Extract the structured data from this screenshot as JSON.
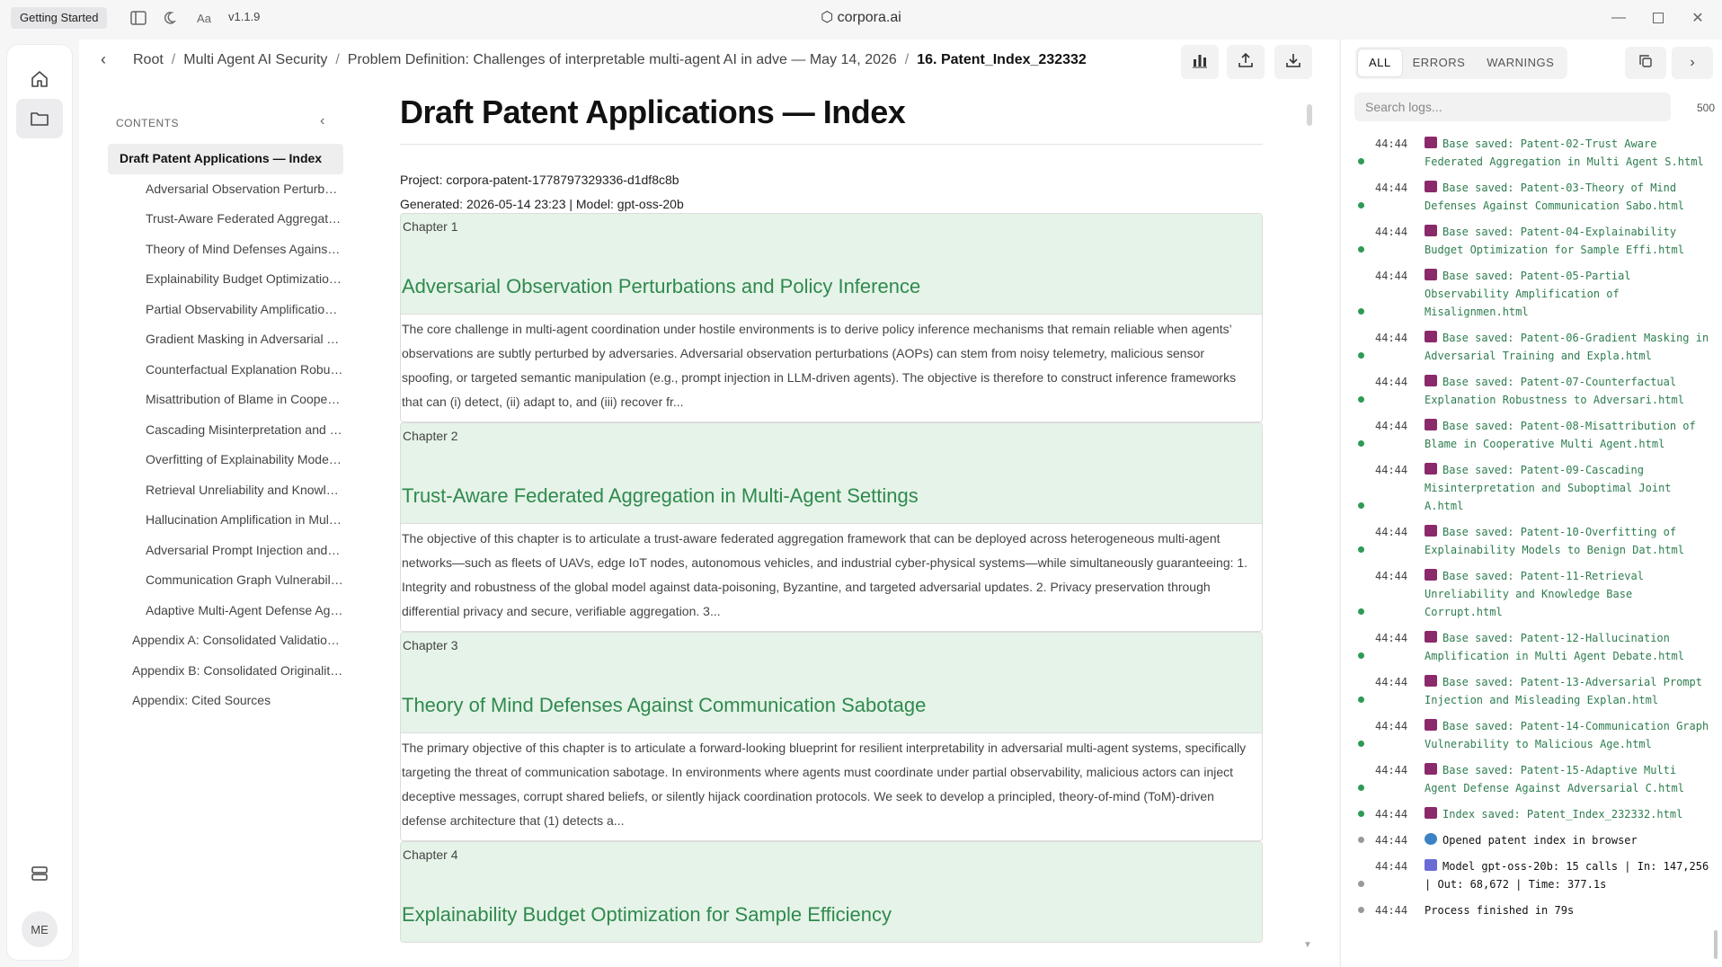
{
  "titlebar": {
    "getting_started": "Getting Started",
    "version": "v1.1.9",
    "app_title": "corpora.ai",
    "icons": [
      "sidebar-toggle-icon",
      "moon-icon",
      "font-size-icon",
      "logo-icon",
      "minimize-icon",
      "maximize-icon",
      "close-icon"
    ]
  },
  "rail": {
    "avatar": "ME",
    "icons": [
      "home-icon",
      "folder-icon",
      "database-icon"
    ]
  },
  "breadcrumb": {
    "items": [
      "Root",
      "Multi Agent AI Security",
      "Problem Definition: Challenges of interpretable multi-agent AI in adve — May 14, 2026"
    ],
    "current": "16. Patent_Index_232332"
  },
  "toc": {
    "heading": "CONTENTS",
    "items": [
      {
        "label": "Draft Patent Applications — Index",
        "level": 0
      },
      {
        "label": "Adversarial Observation Perturbations and Policy Inference",
        "level": 2
      },
      {
        "label": "Trust-Aware Federated Aggregation in Multi-Agent Settings",
        "level": 2
      },
      {
        "label": "Theory of Mind Defenses Against Communication Sabotage",
        "level": 2
      },
      {
        "label": "Explainability Budget Optimization for Sample Efficiency",
        "level": 2
      },
      {
        "label": "Partial Observability Amplification of Misalignment",
        "level": 2
      },
      {
        "label": "Gradient Masking in Adversarial Training and Explanations",
        "level": 2
      },
      {
        "label": "Counterfactual Explanation Robustness to Adversaries",
        "level": 2
      },
      {
        "label": "Misattribution of Blame in Cooperative Multi Agent",
        "level": 2
      },
      {
        "label": "Cascading Misinterpretation and Suboptimal Joint Action",
        "level": 2
      },
      {
        "label": "Overfitting of Explainability Models to Benign Data",
        "level": 2
      },
      {
        "label": "Retrieval Unreliability and Knowledge Base Corruption",
        "level": 2
      },
      {
        "label": "Hallucination Amplification in Multi Agent Debate",
        "level": 2
      },
      {
        "label": "Adversarial Prompt Injection and Misleading Explanations",
        "level": 2
      },
      {
        "label": "Communication Graph Vulnerability to Malicious Agents",
        "level": 2
      },
      {
        "label": "Adaptive Multi-Agent Defense Against Adversarial Collusion",
        "level": 2
      },
      {
        "label": "Appendix A: Consolidated Validation Plan",
        "level": 1
      },
      {
        "label": "Appendix B: Consolidated Originality Review",
        "level": 1
      },
      {
        "label": "Appendix: Cited Sources",
        "level": 1
      }
    ]
  },
  "doc": {
    "title": "Draft Patent Applications — Index",
    "project": "Project: corpora-patent-1778797329336-d1df8c8b",
    "generated": "Generated: 2026-05-14 23:23 | Model: gpt-oss-20b",
    "chapters": [
      {
        "num": "Chapter 1",
        "title": "Adversarial Observation Perturbations and Policy Inference",
        "body": "The core challenge in multi-agent coordination under hostile environments is to derive policy inference mechanisms that remain reliable when agents’ observations are subtly perturbed by adversaries. Adversarial observation perturbations (AOPs) can stem from noisy telemetry, malicious sensor spoofing, or targeted semantic manipulation (e.g., prompt injection in LLM-driven agents). The objective is therefore to construct inference frameworks that can (i) detect, (ii) adapt to, and (iii) recover fr..."
      },
      {
        "num": "Chapter 2",
        "title": "Trust-Aware Federated Aggregation in Multi-Agent Settings",
        "body": "The objective of this chapter is to articulate a trust-aware federated aggregation framework that can be deployed across heterogeneous multi-agent networks—such as fleets of UAVs, edge IoT nodes, autonomous vehicles, and industrial cyber-physical systems—while simultaneously guaranteeing: 1. Integrity and robustness of the global model against data-poisoning, Byzantine, and targeted adversarial updates. 2. Privacy preservation through differential privacy and secure, verifiable aggregation. 3..."
      },
      {
        "num": "Chapter 3",
        "title": "Theory of Mind Defenses Against Communication Sabotage",
        "body": "The primary objective of this chapter is to articulate a forward-looking blueprint for resilient interpretability in adversarial multi-agent systems, specifically targeting the threat of communication sabotage. In environments where agents must coordinate under partial observability, malicious actors can inject deceptive messages, corrupt shared beliefs, or silently hijack coordination protocols. We seek to develop a principled, theory-of-mind (ToM)-driven defense architecture that (1) detects a..."
      },
      {
        "num": "Chapter 4",
        "title": "Explainability Budget Optimization for Sample Efficiency",
        "body": ""
      }
    ]
  },
  "logs_panel": {
    "tabs": [
      "ALL",
      "ERRORS",
      "WARNINGS"
    ],
    "search_placeholder": "Search logs...",
    "count": "500",
    "entries": [
      {
        "time": "44:44",
        "icon": "save",
        "text": "Base saved: Patent-02-Trust Aware Federated Aggregation in Multi Agent S.html",
        "kind": "ok"
      },
      {
        "time": "44:44",
        "icon": "save",
        "text": "Base saved: Patent-03-Theory of Mind Defenses Against Communication Sabo.html",
        "kind": "ok"
      },
      {
        "time": "44:44",
        "icon": "save",
        "text": "Base saved: Patent-04-Explainability Budget Optimization for Sample Effi.html",
        "kind": "ok"
      },
      {
        "time": "44:44",
        "icon": "save",
        "text": "Base saved: Patent-05-Partial Observability Amplification of Misalignmen.html",
        "kind": "ok"
      },
      {
        "time": "44:44",
        "icon": "save",
        "text": "Base saved: Patent-06-Gradient Masking in Adversarial Training and Expla.html",
        "kind": "ok"
      },
      {
        "time": "44:44",
        "icon": "save",
        "text": "Base saved: Patent-07-Counterfactual Explanation Robustness to Adversari.html",
        "kind": "ok"
      },
      {
        "time": "44:44",
        "icon": "save",
        "text": "Base saved: Patent-08-Misattribution of Blame in Cooperative Multi Agent.html",
        "kind": "ok"
      },
      {
        "time": "44:44",
        "icon": "save",
        "text": "Base saved: Patent-09-Cascading Misinterpretation and Suboptimal Joint A.html",
        "kind": "ok"
      },
      {
        "time": "44:44",
        "icon": "save",
        "text": "Base saved: Patent-10-Overfitting of Explainability Models to Benign Dat.html",
        "kind": "ok"
      },
      {
        "time": "44:44",
        "icon": "save",
        "text": "Base saved: Patent-11-Retrieval Unreliability and Knowledge Base Corrupt.html",
        "kind": "ok"
      },
      {
        "time": "44:44",
        "icon": "save",
        "text": "Base saved: Patent-12-Hallucination Amplification in Multi Agent Debate.html",
        "kind": "ok"
      },
      {
        "time": "44:44",
        "icon": "save",
        "text": "Base saved: Patent-13-Adversarial Prompt Injection and Misleading Explan.html",
        "kind": "ok"
      },
      {
        "time": "44:44",
        "icon": "save",
        "text": "Base saved: Patent-14-Communication Graph Vulnerability to Malicious Age.html",
        "kind": "ok"
      },
      {
        "time": "44:44",
        "icon": "save",
        "text": "Base saved: Patent-15-Adaptive Multi Agent Defense Against Adversarial C.html",
        "kind": "ok"
      },
      {
        "time": "44:44",
        "icon": "save",
        "text": "Index saved: Patent_Index_232332.html",
        "kind": "ok"
      },
      {
        "time": "44:44",
        "icon": "globe",
        "text": "Opened patent index in browser",
        "kind": "info"
      },
      {
        "time": "44:44",
        "icon": "chart",
        "text": "Model gpt-oss-20b: 15 calls | In: 147,256 | Out: 68,672 | Time: 377.1s",
        "kind": "info"
      },
      {
        "time": "44:44",
        "icon": "none",
        "text": "Process finished in 79s",
        "kind": "info"
      }
    ]
  },
  "colors": {
    "accent_green": "#2f8a4e",
    "chapter_bg": "#e6f3e8",
    "log_green": "#2e7d4f"
  }
}
